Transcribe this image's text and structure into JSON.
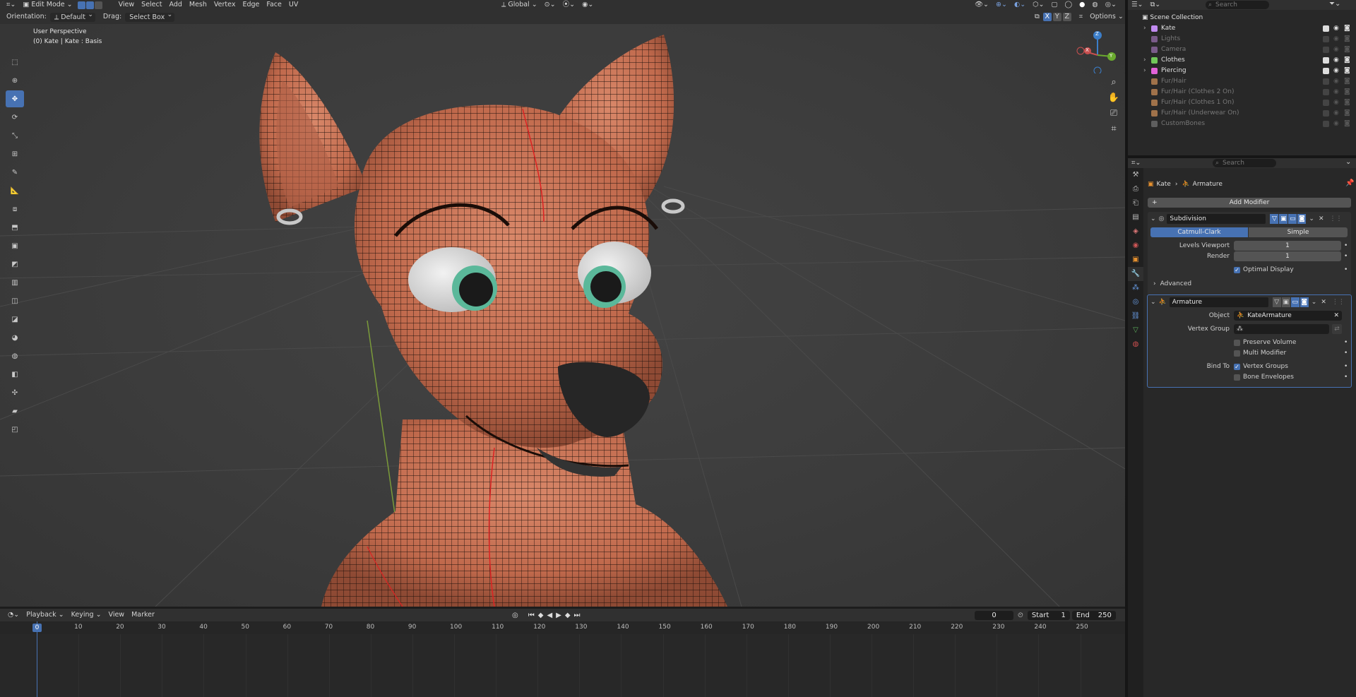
{
  "header": {
    "mode": "Edit Mode",
    "menus": [
      "View",
      "Select",
      "Add",
      "Mesh",
      "Vertex",
      "Edge",
      "Face",
      "UV"
    ],
    "transform_orientation": "Global",
    "search_placeholder": "Search"
  },
  "toolheader": {
    "orientation_label": "Orientation:",
    "orientation_value": "Default",
    "drag_label": "Drag:",
    "drag_value": "Select Box",
    "axis_x": "X",
    "axis_y": "Y",
    "axis_z": "Z",
    "options_label": "Options"
  },
  "viewport": {
    "perspective": "User Perspective",
    "object_info": "(0) Kate | Kate : Basis",
    "gizmo": {
      "x": "X",
      "y": "Y",
      "z": "Z"
    }
  },
  "tools": [
    "select-box",
    "cursor",
    "move",
    "rotate",
    "scale",
    "transform",
    "annotate",
    "measure",
    "add-cube",
    "extrude",
    "inset",
    "bevel",
    "loop-cut",
    "knife",
    "poly-build",
    "spin",
    "smooth",
    "edge-slide",
    "shrink-fatten",
    "shear",
    "rip"
  ],
  "outliner": {
    "title": "Scene Collection",
    "items": [
      {
        "label": "Kate",
        "color": "#c18bf0",
        "expandable": true,
        "enabled": true
      },
      {
        "label": "Lights",
        "color": "#7a5b8a",
        "expandable": false,
        "enabled": false
      },
      {
        "label": "Camera",
        "color": "#7a5b8a",
        "expandable": false,
        "enabled": false
      },
      {
        "label": "Clothes",
        "color": "#71c75a",
        "expandable": true,
        "enabled": true
      },
      {
        "label": "Piercing",
        "color": "#e263d8",
        "expandable": true,
        "enabled": true
      },
      {
        "label": "Fur/Hair",
        "color": "#a0724a",
        "expandable": false,
        "enabled": false
      },
      {
        "label": "Fur/Hair (Clothes 2 On)",
        "color": "#a0724a",
        "expandable": false,
        "enabled": false
      },
      {
        "label": "Fur/Hair (Clothes 1 On)",
        "color": "#a0724a",
        "expandable": false,
        "enabled": false
      },
      {
        "label": "Fur/Hair (Underwear On)",
        "color": "#a0724a",
        "expandable": false,
        "enabled": false
      },
      {
        "label": "CustomBones",
        "color": "#5e5e5e",
        "expandable": false,
        "enabled": false
      }
    ]
  },
  "properties": {
    "search_placeholder": "Search",
    "breadcrumb_object": "Kate",
    "breadcrumb_data": "Armature",
    "add_modifier": "Add Modifier",
    "subdivision": {
      "name": "Subdivision",
      "tab_catmull": "Catmull-Clark",
      "tab_simple": "Simple",
      "levels_label": "Levels Viewport",
      "levels_value": "1",
      "render_label": "Render",
      "render_value": "1",
      "optimal_display": "Optimal Display",
      "advanced": "Advanced"
    },
    "armature": {
      "name": "Armature",
      "object_label": "Object",
      "object_value": "KateArmature",
      "vertex_group_label": "Vertex Group",
      "preserve_volume": "Preserve Volume",
      "multi_modifier": "Multi Modifier",
      "bind_to_label": "Bind To",
      "vertex_groups": "Vertex Groups",
      "bone_envelopes": "Bone Envelopes"
    }
  },
  "timeline": {
    "menus": [
      "Playback",
      "Keying",
      "View",
      "Marker"
    ],
    "current_frame": "0",
    "start_label": "Start",
    "start_value": "1",
    "end_label": "End",
    "end_value": "250",
    "ticks": [
      "0",
      "10",
      "20",
      "30",
      "40",
      "50",
      "60",
      "70",
      "80",
      "90",
      "100",
      "110",
      "120",
      "130",
      "140",
      "150",
      "160",
      "170",
      "180",
      "190",
      "200",
      "210",
      "220",
      "230",
      "240",
      "250"
    ]
  },
  "colors": {
    "accent": "#4772b3",
    "skin": "#c9785a",
    "eye_iris": "#5bb89a",
    "header_bg": "#303030",
    "panel_bg": "#282828"
  }
}
